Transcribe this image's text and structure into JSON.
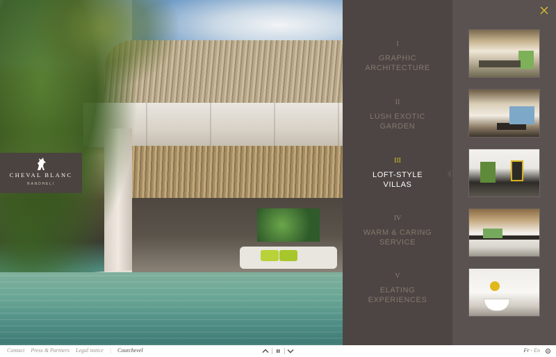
{
  "logo": {
    "brand": "CHEVAL BLANC",
    "location": "RANDHELI"
  },
  "menu": {
    "items": [
      {
        "num": "I",
        "label": "GRAPHIC\nARCHITECTURE",
        "active": false
      },
      {
        "num": "II",
        "label": "LUSH EXOTIC\nGARDEN",
        "active": false
      },
      {
        "num": "III",
        "label": "LOFT-STYLE\nVILLAS",
        "active": true
      },
      {
        "num": "IV",
        "label": "WARM & CARING\nSERVICE",
        "active": false
      },
      {
        "num": "V",
        "label": "ELATING\nEXPERIENCES",
        "active": false
      }
    ]
  },
  "close": {
    "icon": "close-icon"
  },
  "footer": {
    "links": [
      "Contact",
      "Press & Partners",
      "Legal notice"
    ],
    "separator": "|",
    "location": "Courchevel",
    "controls": [
      "chevron-up-icon",
      "pause-icon",
      "chevron-down-icon"
    ],
    "lang_current": "Fr",
    "lang_sep": "-",
    "lang_other": "En",
    "share_icon": "social-icon"
  },
  "colors": {
    "menu_bg": "#4c4543",
    "thumb_bg": "#5a5250",
    "accent": "#d7be2b",
    "active_text": "#ffffff",
    "inactive_text": "#85796d"
  }
}
